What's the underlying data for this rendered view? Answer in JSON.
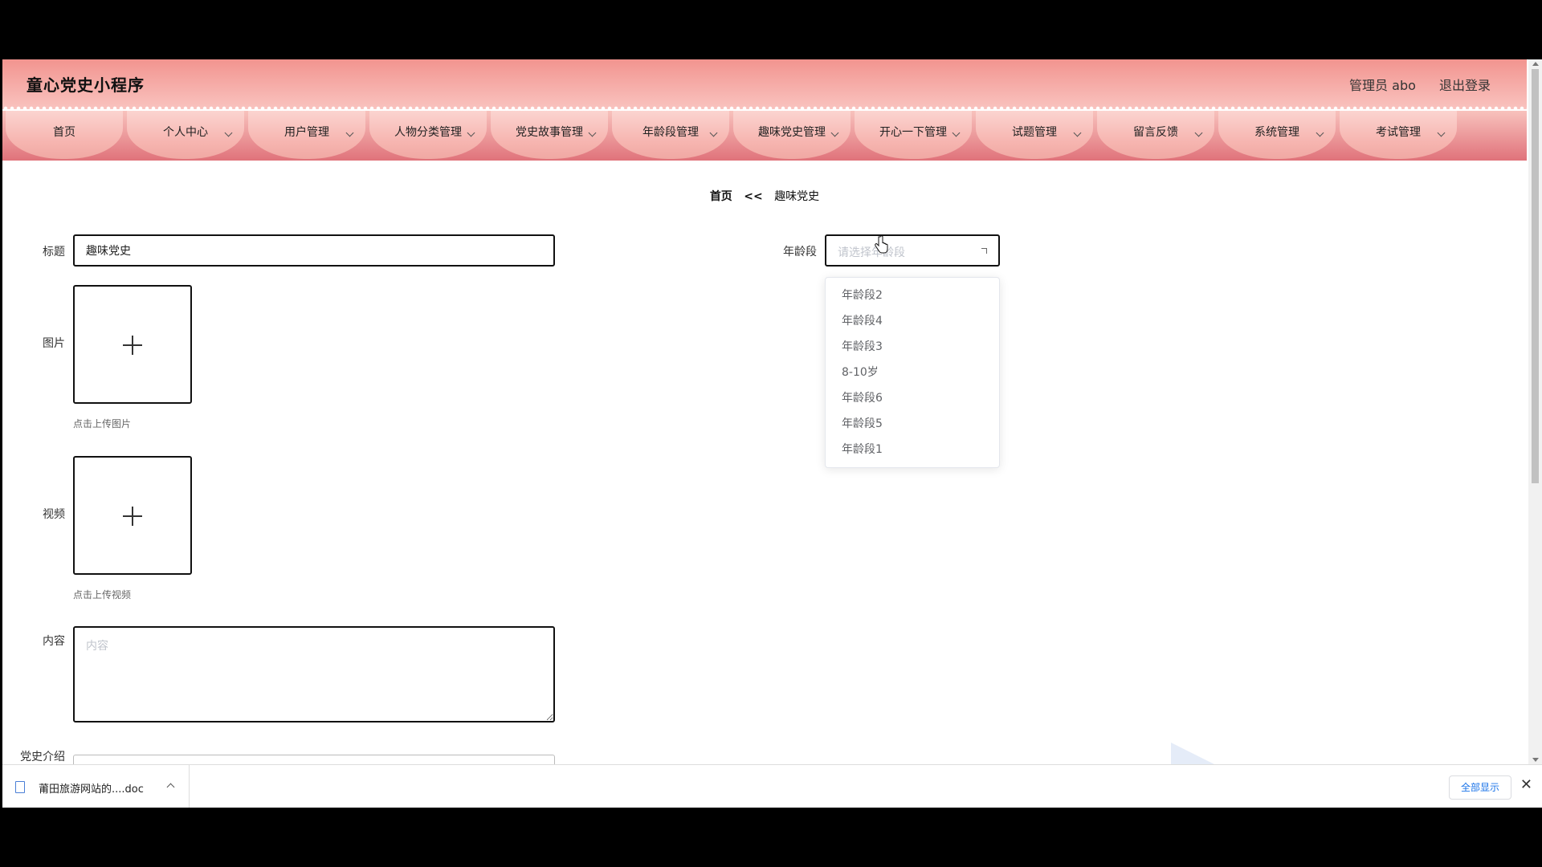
{
  "header": {
    "app_title": "童心党史小程序",
    "user_label": "管理员 abo",
    "logout_label": "退出登录"
  },
  "nav": {
    "items": [
      {
        "label": "首页",
        "has_dropdown": false
      },
      {
        "label": "个人中心",
        "has_dropdown": true
      },
      {
        "label": "用户管理",
        "has_dropdown": true
      },
      {
        "label": "人物分类管理",
        "has_dropdown": true
      },
      {
        "label": "党史故事管理",
        "has_dropdown": true
      },
      {
        "label": "年龄段管理",
        "has_dropdown": true
      },
      {
        "label": "趣味党史管理",
        "has_dropdown": true
      },
      {
        "label": "开心一下管理",
        "has_dropdown": true
      },
      {
        "label": "试题管理",
        "has_dropdown": true
      },
      {
        "label": "留言反馈",
        "has_dropdown": true
      },
      {
        "label": "系统管理",
        "has_dropdown": true
      },
      {
        "label": "考试管理",
        "has_dropdown": true
      }
    ]
  },
  "breadcrumb": {
    "home": "首页",
    "separator": "<<",
    "current": "趣味党史"
  },
  "form": {
    "title_label": "标题",
    "title_value": "趣味党史",
    "image_label": "图片",
    "image_tip": "点击上传图片",
    "video_label": "视频",
    "video_tip": "点击上传视频",
    "content_label": "内容",
    "content_placeholder": "内容",
    "history_intro_label": "党史介绍",
    "age_label": "年龄段",
    "age_placeholder": "请选择年龄段",
    "age_options": [
      "年龄段2",
      "年龄段4",
      "年龄段3",
      "8-10岁",
      "年龄段6",
      "年龄段5",
      "年龄段1"
    ]
  },
  "download_bar": {
    "file_name": "莆田旅游网站的....doc",
    "show_all_label": "全部显示",
    "close_symbol": "✕"
  },
  "colors": {
    "header_top": "#f2948f",
    "nav_bottom": "#e0727a",
    "tab_fill": "#f7b7b2"
  }
}
